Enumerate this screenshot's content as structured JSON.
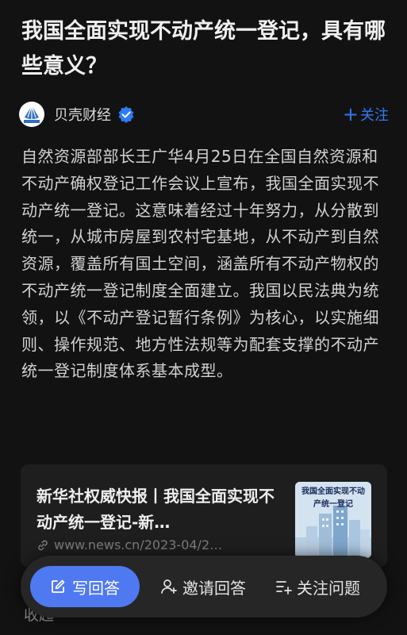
{
  "question": {
    "title": "我国全面实现不动产统一登记，具有哪些意义？"
  },
  "author": {
    "name": "贝壳财经",
    "avatar_text": "贝壳财经",
    "verified_icon": "verified-badge-icon",
    "follow_label": "关注",
    "follow_plus": "+"
  },
  "answer": {
    "text": "自然资源部部长王广华4月25日在全国自然资源和不动产确权登记工作会议上宣布，我国全面实现不动产统一登记。这意味着经过十年努力，从分散到统一，从城市房屋到农村宅基地，从不动产到自然资源，覆盖所有国土空间，涵盖所有不动产物权的不动产统一登记制度全面建立。我国以民法典为统领，以《不动产登记暂行条例》为核心，以实施细则、操作规范、地方性法规等为配套支撑的不动产统一登记制度体系基本成型。"
  },
  "link_card": {
    "title": "新华社权威快报丨我国全面实现不动产统一登记-新…",
    "url": "www.news.cn/2023-04/2…",
    "thumbnail_text": "我国全面实现不动产统一登记"
  },
  "bottom_bar": {
    "write_answer": "写回答",
    "invite_answer": "邀请回答",
    "follow_question": "关注问题"
  },
  "collapse": {
    "label": "收起",
    "dash": "－"
  },
  "colors": {
    "background": "#121212",
    "accent_blue": "#2f7bf6",
    "write_button": "#4f79f0",
    "card": "#1e1e1e"
  }
}
